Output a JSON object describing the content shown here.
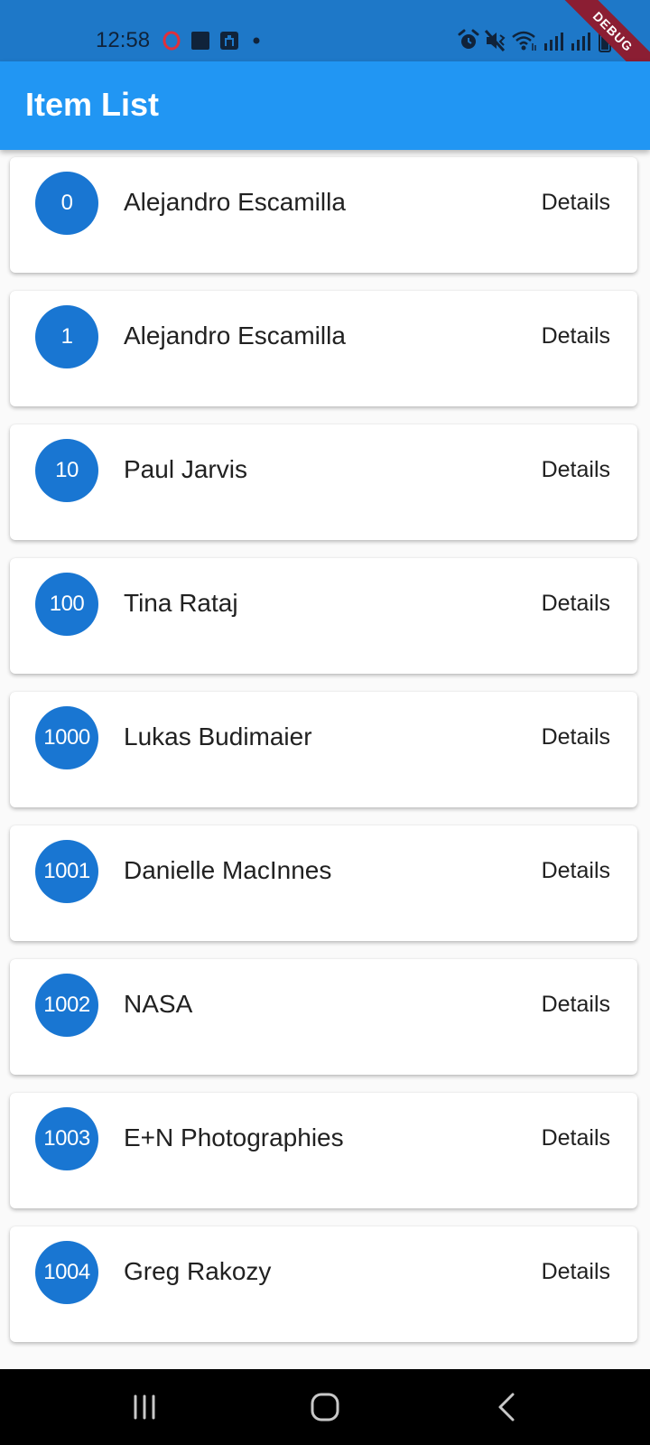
{
  "status_bar": {
    "time": "12:58",
    "notification_icons": [
      "opera-icon",
      "square-app-icon",
      "sim-icon",
      "dot-icon"
    ],
    "system_icons": [
      "alarm-icon",
      "mute-icon",
      "wifi-icon",
      "signal-icon",
      "signal-icon",
      "battery-icon"
    ]
  },
  "debug_banner": "DEBUG",
  "app_bar": {
    "title": "Item List",
    "color": "#2196f3"
  },
  "items": [
    {
      "id": "0",
      "name": "Alejandro Escamilla",
      "action": "Details"
    },
    {
      "id": "1",
      "name": "Alejandro Escamilla",
      "action": "Details"
    },
    {
      "id": "10",
      "name": "Paul Jarvis",
      "action": "Details"
    },
    {
      "id": "100",
      "name": "Tina Rataj",
      "action": "Details"
    },
    {
      "id": "1000",
      "name": "Lukas Budimaier",
      "action": "Details"
    },
    {
      "id": "1001",
      "name": "Danielle MacInnes",
      "action": "Details"
    },
    {
      "id": "1002",
      "name": "NASA",
      "action": "Details"
    },
    {
      "id": "1003",
      "name": "E+N Photographies",
      "action": "Details"
    },
    {
      "id": "1004",
      "name": "Greg Rakozy",
      "action": "Details"
    }
  ],
  "nav_bar": {
    "buttons": [
      "recents-icon",
      "home-icon",
      "back-icon"
    ]
  }
}
